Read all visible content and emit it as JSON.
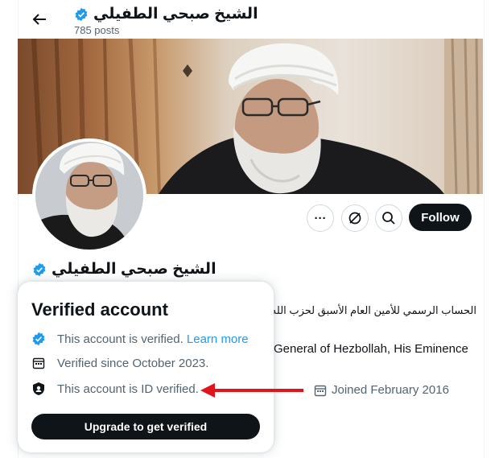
{
  "header": {
    "name": "الشيخ صبحي الطفيلي",
    "posts": "785 posts"
  },
  "actions": {
    "more_label": "···",
    "follow_label": "Follow"
  },
  "profile": {
    "name": "الشيخ صبحي الطفيلي",
    "bio_arabic": "الحساب الرسمي للأمين العام الأسبق لحزب الله سماحة",
    "bio_english": "General of Hezbollah, His Eminence",
    "joined": "Joined February 2016"
  },
  "popover": {
    "title": "Verified account",
    "verified_text": "This account is verified.",
    "learn_more": "Learn more",
    "since_text": "Verified since October 2023.",
    "id_text": "This account is ID verified.",
    "upgrade_label": "Upgrade to get verified"
  },
  "colors": {
    "brand_blue": "#1d9bf0",
    "button_dark": "#0f1419",
    "annotation_red": "#e0151c"
  },
  "icons": {
    "back": "arrow-left-icon",
    "badge": "verified-badge-icon",
    "calendar": "calendar-icon",
    "id_shield": "id-shield-icon",
    "notifications_off": "bell-off-icon",
    "search": "search-icon"
  }
}
